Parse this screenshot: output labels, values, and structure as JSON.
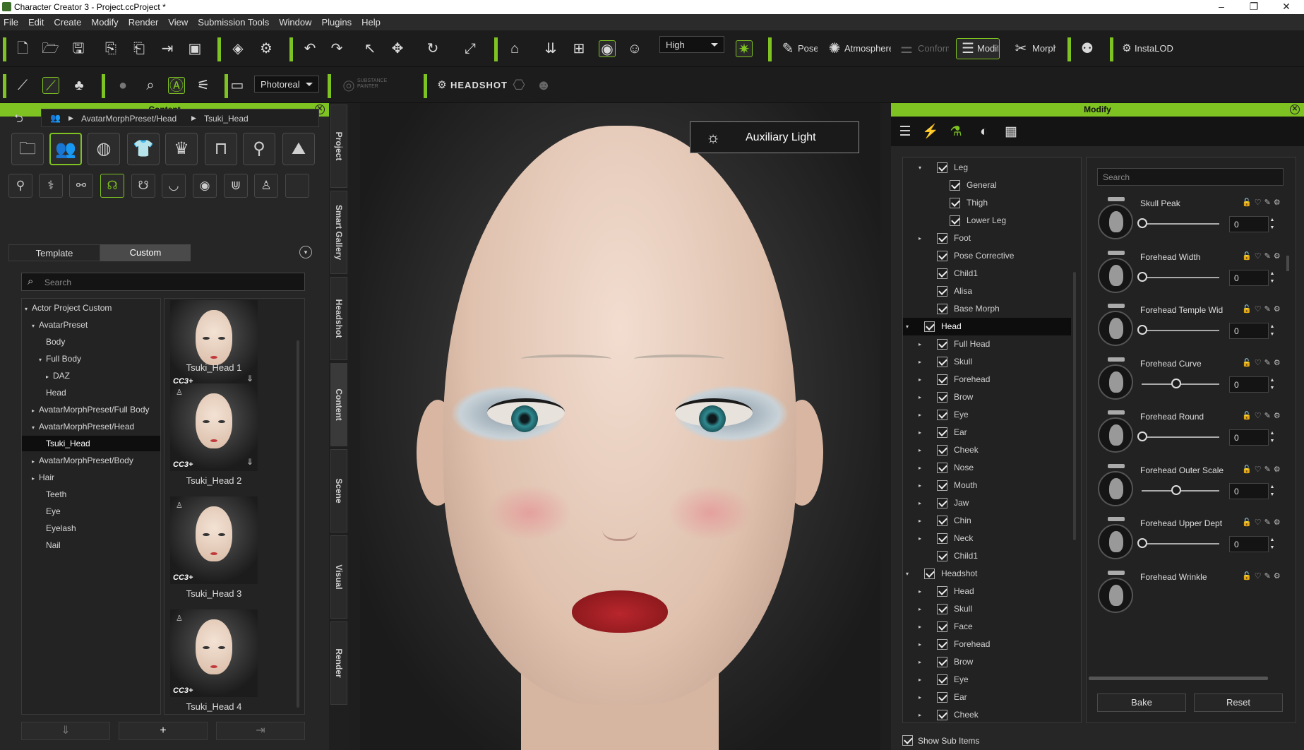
{
  "window": {
    "title": "Character Creator 3 - Project.ccProject *"
  },
  "menu": [
    "File",
    "Edit",
    "Create",
    "Modify",
    "Render",
    "View",
    "Submission Tools",
    "Window",
    "Plugins",
    "Help"
  ],
  "toolbar1": {
    "quality": "High",
    "pose": "Pose",
    "atmosphere": "Atmosphere",
    "conform": "Conform",
    "modify": "Modify",
    "morph": "Morph",
    "instalod": "InstaLOD"
  },
  "toolbar2": {
    "render_mode": "Photoreal",
    "substance": "SUBSTANCE PAINTER",
    "headshot": "HEADSHOT"
  },
  "content_panel": {
    "title": "Content",
    "breadcrumb": [
      "AvatarMorphPreset/Head",
      "Tsuki_Head"
    ],
    "tabs": [
      "Template",
      "Custom"
    ],
    "search_placeholder": "Search",
    "tree": [
      {
        "label": "Actor Project Custom",
        "indent": 0,
        "arrow": "▾"
      },
      {
        "label": "AvatarPreset",
        "indent": 1,
        "arrow": "▾"
      },
      {
        "label": "Body",
        "indent": 2,
        "arrow": ""
      },
      {
        "label": "Full Body",
        "indent": 2,
        "arrow": "▾"
      },
      {
        "label": "DAZ",
        "indent": 3,
        "arrow": "▸"
      },
      {
        "label": "Head",
        "indent": 2,
        "arrow": ""
      },
      {
        "label": "AvatarMorphPreset/Full Body",
        "indent": 1,
        "arrow": "▸"
      },
      {
        "label": "AvatarMorphPreset/Head",
        "indent": 1,
        "arrow": "▾"
      },
      {
        "label": "Tsuki_Head",
        "indent": 2,
        "arrow": "",
        "selected": true
      },
      {
        "label": "AvatarMorphPreset/Body",
        "indent": 1,
        "arrow": "▸"
      },
      {
        "label": "Hair",
        "indent": 1,
        "arrow": "▸"
      },
      {
        "label": "Teeth",
        "indent": 2,
        "arrow": ""
      },
      {
        "label": "Eye",
        "indent": 2,
        "arrow": ""
      },
      {
        "label": "Eyelash",
        "indent": 2,
        "arrow": ""
      },
      {
        "label": "Nail",
        "indent": 2,
        "arrow": ""
      }
    ],
    "thumbnails": [
      "Tsuki_Head 1",
      "Tsuki_Head 2",
      "Tsuki_Head 3",
      "Tsuki_Head 4"
    ],
    "thumb_badge": "CC3+",
    "add_label": "+"
  },
  "side_tabs": [
    "Project",
    "Smart Gallery",
    "Headshot",
    "Content",
    "Scene",
    "Visual",
    "Render"
  ],
  "viewport": {
    "aux_light": "Auxiliary Light"
  },
  "modify_panel": {
    "title": "Modify",
    "tree": [
      {
        "label": "Leg",
        "level": 1,
        "arrow": "▾"
      },
      {
        "label": "General",
        "level": 2,
        "arrow": ""
      },
      {
        "label": "Thigh",
        "level": 2,
        "arrow": ""
      },
      {
        "label": "Lower Leg",
        "level": 2,
        "arrow": ""
      },
      {
        "label": "Foot",
        "level": 1,
        "arrow": "▸"
      },
      {
        "label": "Pose Corrective",
        "level": 1,
        "arrow": ""
      },
      {
        "label": "Child1",
        "level": 1,
        "arrow": ""
      },
      {
        "label": "Alisa",
        "level": 1,
        "arrow": ""
      },
      {
        "label": "Base Morph",
        "level": 1,
        "arrow": ""
      },
      {
        "label": "Head",
        "level": 0,
        "arrow": "▾",
        "selected": true
      },
      {
        "label": "Full Head",
        "level": 1,
        "arrow": "▸"
      },
      {
        "label": "Skull",
        "level": 1,
        "arrow": "▸"
      },
      {
        "label": "Forehead",
        "level": 1,
        "arrow": "▸"
      },
      {
        "label": "Brow",
        "level": 1,
        "arrow": "▸"
      },
      {
        "label": "Eye",
        "level": 1,
        "arrow": "▸"
      },
      {
        "label": "Ear",
        "level": 1,
        "arrow": "▸"
      },
      {
        "label": "Cheek",
        "level": 1,
        "arrow": "▸"
      },
      {
        "label": "Nose",
        "level": 1,
        "arrow": "▸"
      },
      {
        "label": "Mouth",
        "level": 1,
        "arrow": "▸"
      },
      {
        "label": "Jaw",
        "level": 1,
        "arrow": "▸"
      },
      {
        "label": "Chin",
        "level": 1,
        "arrow": "▸"
      },
      {
        "label": "Neck",
        "level": 1,
        "arrow": "▸"
      },
      {
        "label": "Child1",
        "level": 1,
        "arrow": ""
      },
      {
        "label": "Headshot",
        "level": 0,
        "arrow": "▾"
      },
      {
        "label": "Head",
        "level": 1,
        "arrow": "▸"
      },
      {
        "label": "Skull",
        "level": 1,
        "arrow": "▸"
      },
      {
        "label": "Face",
        "level": 1,
        "arrow": "▸"
      },
      {
        "label": "Forehead",
        "level": 1,
        "arrow": "▸"
      },
      {
        "label": "Brow",
        "level": 1,
        "arrow": "▸"
      },
      {
        "label": "Eye",
        "level": 1,
        "arrow": "▸"
      },
      {
        "label": "Ear",
        "level": 1,
        "arrow": "▸"
      },
      {
        "label": "Cheek",
        "level": 1,
        "arrow": "▸"
      }
    ],
    "search_placeholder": "Search",
    "sliders": [
      {
        "name": "Skull Peak",
        "value": "0",
        "pos": 0
      },
      {
        "name": "Forehead Width",
        "value": "0",
        "pos": 0
      },
      {
        "name": "Forehead Temple Wid",
        "value": "0",
        "pos": 0
      },
      {
        "name": "Forehead Curve",
        "value": "0",
        "pos": 0.5
      },
      {
        "name": "Forehead Round",
        "value": "0",
        "pos": 0
      },
      {
        "name": "Forehead Outer Scale",
        "value": "0",
        "pos": 0.5
      },
      {
        "name": "Forehead Upper Dept",
        "value": "0",
        "pos": 0
      },
      {
        "name": "Forehead Wrinkle",
        "value": "",
        "pos": 0
      }
    ],
    "bake": "Bake",
    "reset": "Reset",
    "show_sub_items": "Show Sub Items"
  },
  "colors": {
    "accent": "#7ec321",
    "background": "#1e1e1e"
  }
}
